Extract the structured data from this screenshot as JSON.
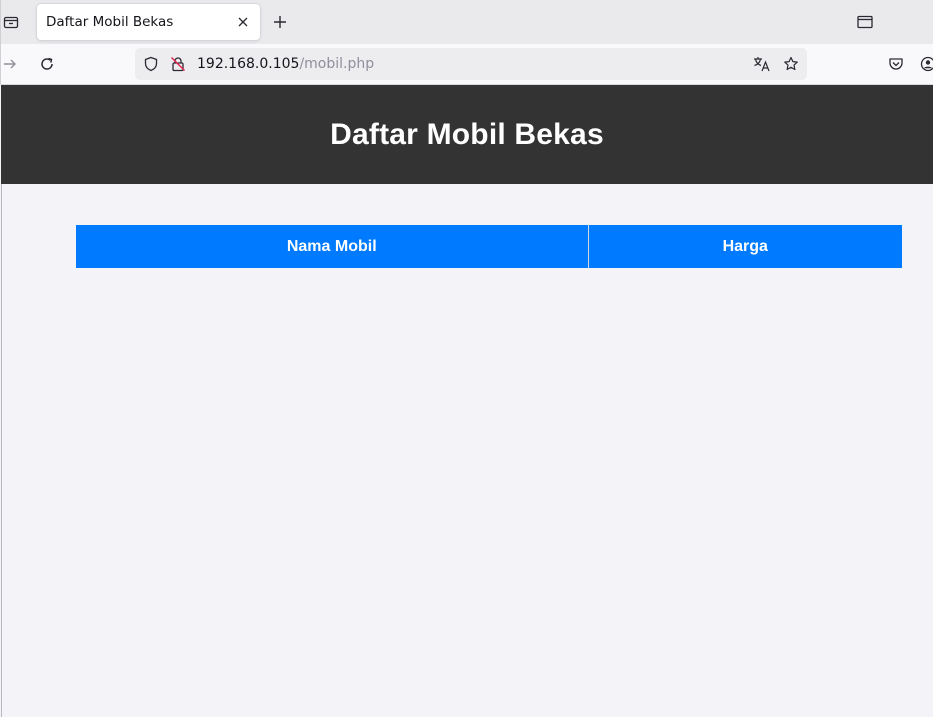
{
  "browser": {
    "tab": {
      "title": "Daftar Mobil Bekas"
    },
    "url": {
      "host": "192.168.0.105",
      "path": "/mobil.php"
    }
  },
  "page": {
    "title": "Daftar Mobil Bekas",
    "table": {
      "columns": [
        "Nama Mobil",
        "Harga"
      ],
      "rows": []
    }
  },
  "colors": {
    "header_bg": "#333333",
    "table_header_bg": "#007bff",
    "page_bg": "#f4f4f8"
  }
}
